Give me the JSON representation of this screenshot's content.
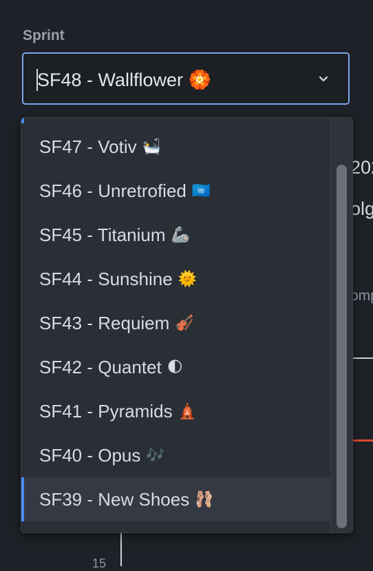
{
  "sprint_field": {
    "label": "Sprint",
    "selected_value": "SF48 - Wallflower 🏵️"
  },
  "dropdown": {
    "options": [
      {
        "label": "SF47 - Votiv",
        "emoji": "🛀"
      },
      {
        "label": "SF46 - Unretrofied",
        "emoji": "🇺🇳"
      },
      {
        "label": "SF45 - Titanium",
        "emoji": "🦾"
      },
      {
        "label": "SF44 - Sunshine",
        "emoji": "🌞"
      },
      {
        "label": "SF43 - Requiem",
        "emoji": "🎻"
      },
      {
        "label": "SF42 - Quantet",
        "emoji": "🌓"
      },
      {
        "label": "SF41 - Pyramids",
        "emoji": "🛕"
      },
      {
        "label": "SF40 - Opus",
        "emoji": "🎶"
      },
      {
        "label": "SF39 - New Shoes",
        "emoji": "🩰"
      }
    ],
    "selected_index": 8
  },
  "background": {
    "frag_1": "202",
    "frag_2": "olg",
    "frag_3": "omp",
    "axis_tick": "15"
  },
  "colors": {
    "accent": "#4a8cf0",
    "focus_border": "#7aa6e8",
    "dropdown_bg": "#2a2e35",
    "page_bg": "#1e2127",
    "chart_line_red": "#e04a2f"
  }
}
